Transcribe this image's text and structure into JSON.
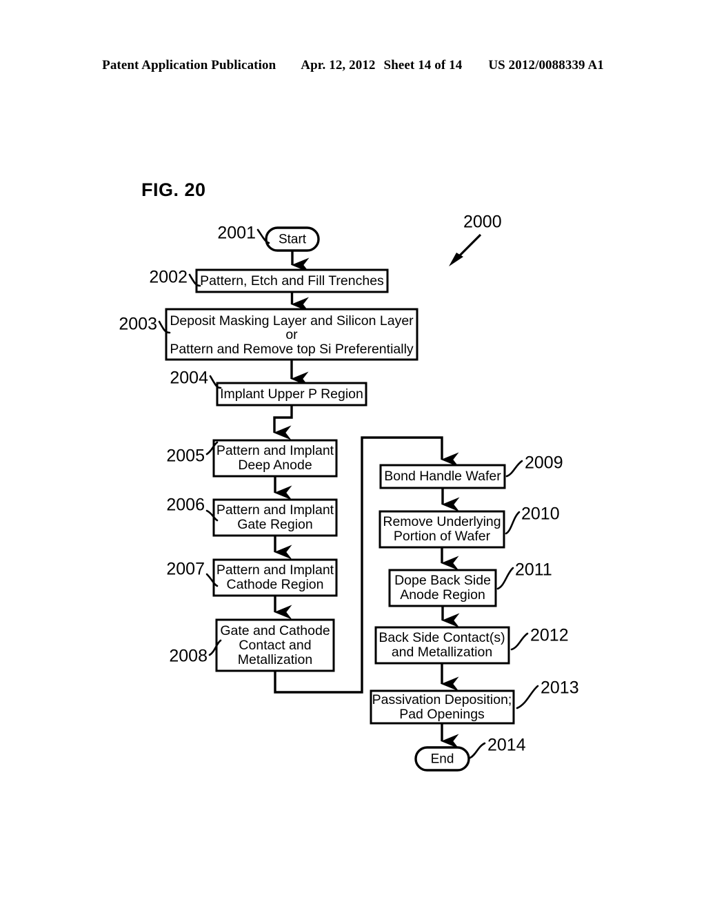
{
  "header": {
    "publication": "Patent Application Publication",
    "date": "Apr. 12, 2012",
    "sheet": "Sheet 14 of 14",
    "number": "US 2012/0088339 A1"
  },
  "figure": {
    "label": "FIG. 20",
    "diagram_ref": "2000"
  },
  "flowchart": {
    "type": "process-flow",
    "nodes": [
      {
        "ref": "2001",
        "shape": "terminator",
        "text": "Start",
        "lines": [
          "Start"
        ],
        "column": "main"
      },
      {
        "ref": "2002",
        "shape": "process",
        "text": "Pattern, Etch and Fill Trenches",
        "lines": [
          "Pattern, Etch and Fill Trenches"
        ],
        "column": "main"
      },
      {
        "ref": "2003",
        "shape": "process",
        "text": "Deposit Masking Layer and Silicon Layer or Pattern and Remove top Si Preferentially",
        "lines": [
          "Deposit Masking Layer and Silicon Layer",
          "or",
          "Pattern and Remove top Si Preferentially"
        ],
        "column": "main"
      },
      {
        "ref": "2004",
        "shape": "process",
        "text": "Implant Upper P Region",
        "lines": [
          "Implant Upper P Region"
        ],
        "column": "main"
      },
      {
        "ref": "2005",
        "shape": "process",
        "text": "Pattern and Implant Deep Anode",
        "lines": [
          "Pattern and Implant",
          "Deep Anode"
        ],
        "column": "left"
      },
      {
        "ref": "2006",
        "shape": "process",
        "text": "Pattern and Implant Gate Region",
        "lines": [
          "Pattern and Implant",
          "Gate Region"
        ],
        "column": "left"
      },
      {
        "ref": "2007",
        "shape": "process",
        "text": "Pattern and Implant Cathode Region",
        "lines": [
          "Pattern and Implant",
          "Cathode Region"
        ],
        "column": "left"
      },
      {
        "ref": "2008",
        "shape": "process",
        "text": "Gate and Cathode Contact and Metallization",
        "lines": [
          "Gate and Cathode",
          "Contact and",
          "Metallization"
        ],
        "column": "left"
      },
      {
        "ref": "2009",
        "shape": "process",
        "text": "Bond Handle Wafer",
        "lines": [
          "Bond Handle Wafer"
        ],
        "column": "right"
      },
      {
        "ref": "2010",
        "shape": "process",
        "text": "Remove Underlying Portion of Wafer",
        "lines": [
          "Remove Underlying",
          "Portion of Wafer"
        ],
        "column": "right"
      },
      {
        "ref": "2011",
        "shape": "process",
        "text": "Dope Back Side Anode Region",
        "lines": [
          "Dope Back Side",
          "Anode Region"
        ],
        "column": "right"
      },
      {
        "ref": "2012",
        "shape": "process",
        "text": "Back Side Contact(s) and Metallization",
        "lines": [
          "Back Side Contact(s)",
          "and Metallization"
        ],
        "column": "right"
      },
      {
        "ref": "2013",
        "shape": "process",
        "text": "Passivation Deposition; Pad Openings",
        "lines": [
          "Passivation Deposition;",
          "Pad Openings"
        ],
        "column": "right"
      },
      {
        "ref": "2014",
        "shape": "terminator",
        "text": "End",
        "lines": [
          "End"
        ],
        "column": "right"
      }
    ],
    "edges": [
      {
        "from": "2001",
        "to": "2002"
      },
      {
        "from": "2002",
        "to": "2003"
      },
      {
        "from": "2003",
        "to": "2004"
      },
      {
        "from": "2004",
        "to": "2005"
      },
      {
        "from": "2005",
        "to": "2006"
      },
      {
        "from": "2006",
        "to": "2007"
      },
      {
        "from": "2007",
        "to": "2008"
      },
      {
        "from": "2008",
        "to": "2009"
      },
      {
        "from": "2009",
        "to": "2010"
      },
      {
        "from": "2010",
        "to": "2011"
      },
      {
        "from": "2011",
        "to": "2012"
      },
      {
        "from": "2012",
        "to": "2013"
      },
      {
        "from": "2013",
        "to": "2014"
      }
    ]
  },
  "text": {
    "n2001": "2001",
    "n2002": "2002",
    "n2003": "2003",
    "n2004": "2004",
    "n2005": "2005",
    "n2006": "2006",
    "n2007": "2007",
    "n2008": "2008",
    "n2009": "2009",
    "n2010": "2010",
    "n2011": "2011",
    "n2012": "2012",
    "n2013": "2013",
    "n2014": "2014",
    "n2000": "2000",
    "t_start": "Start",
    "t_end": "End",
    "b2002": "Pattern, Etch and Fill Trenches",
    "b2003_l1": "Deposit Masking Layer and Silicon Layer",
    "b2003_l2": "or",
    "b2003_l3": "Pattern and Remove top Si Preferentially",
    "b2004": "Implant Upper P Region",
    "b2005_l1": "Pattern and Implant",
    "b2005_l2": "Deep Anode",
    "b2006_l1": "Pattern and Implant",
    "b2006_l2": "Gate Region",
    "b2007_l1": "Pattern and Implant",
    "b2007_l2": "Cathode Region",
    "b2008_l1": "Gate and Cathode",
    "b2008_l2": "Contact and",
    "b2008_l3": "Metallization",
    "b2009": "Bond Handle Wafer",
    "b2010_l1": "Remove Underlying",
    "b2010_l2": "Portion of Wafer",
    "b2011_l1": "Dope Back Side",
    "b2011_l2": "Anode Region",
    "b2012_l1": "Back Side Contact(s)",
    "b2012_l2": "and Metallization",
    "b2013_l1": "Passivation Deposition;",
    "b2013_l2": "Pad Openings"
  },
  "colors": {
    "ink": "#000000",
    "paper": "#ffffff"
  }
}
